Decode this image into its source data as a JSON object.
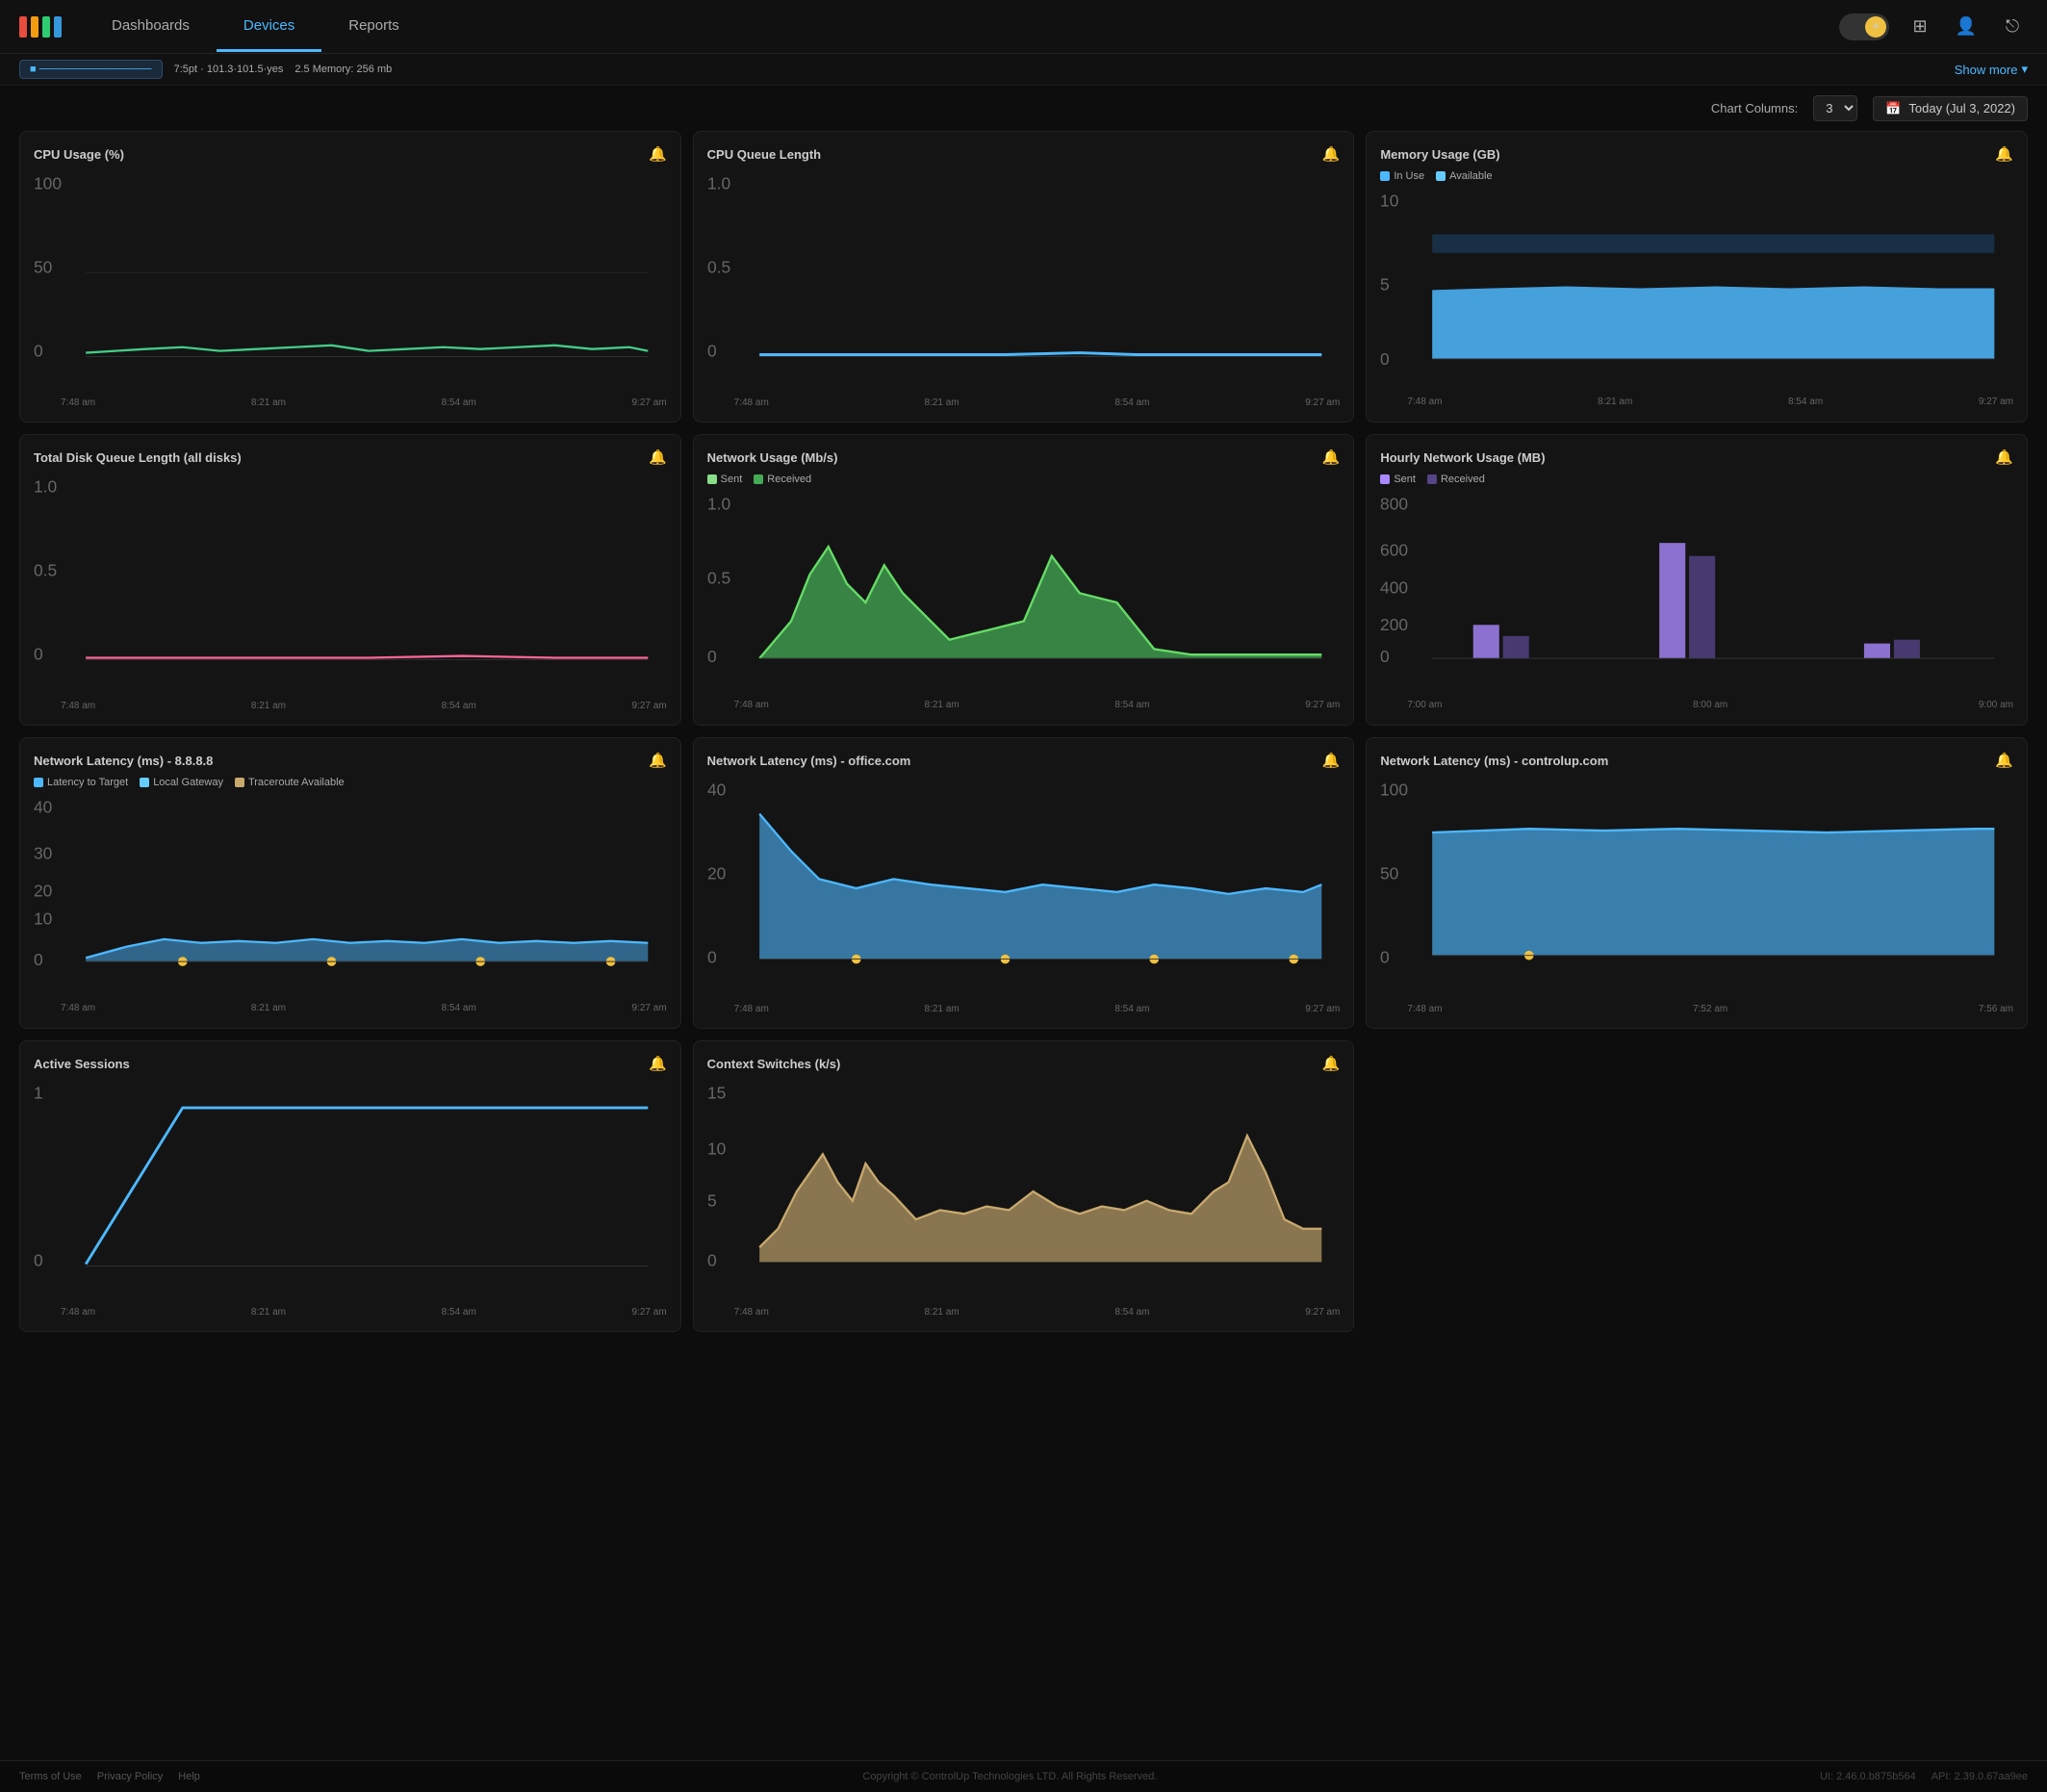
{
  "navbar": {
    "tabs": [
      {
        "id": "dashboards",
        "label": "Dashboards",
        "active": false
      },
      {
        "id": "devices",
        "label": "Devices",
        "active": true
      },
      {
        "id": "reports",
        "label": "Reports",
        "active": false
      }
    ],
    "theme_toggle_icon": "☀",
    "icons": [
      "⊞",
      "👤",
      "→"
    ]
  },
  "topbar": {
    "device_chip": "■ ────────────────",
    "info_items": [
      "7:5pt",
      "101.3·101.5·yes",
      "2.5 Memory: 256 mb"
    ],
    "show_more": "Show more"
  },
  "toolbar": {
    "chart_columns_label": "Chart Columns:",
    "columns_value": "3",
    "date_label": "Today (Jul 3, 2022)"
  },
  "charts": [
    {
      "id": "cpu-usage",
      "title": "CPU Usage (%)",
      "y_max": "100",
      "y_mid": "50",
      "y_min": "0",
      "x_labels": [
        "7:48 am",
        "8:21 am",
        "8:54 am",
        "9:27 am"
      ],
      "color": "#44cc88",
      "type": "line",
      "legend": []
    },
    {
      "id": "cpu-queue",
      "title": "CPU Queue Length",
      "y_max": "1.0",
      "y_mid": "0.5",
      "y_min": "0",
      "x_labels": [
        "7:48 am",
        "8:21 am",
        "8:54 am",
        "9:27 am"
      ],
      "color": "#4db8ff",
      "type": "line",
      "legend": []
    },
    {
      "id": "memory-usage",
      "title": "Memory Usage (GB)",
      "y_max": "10",
      "y_mid": "5",
      "y_min": "0",
      "x_labels": [
        "7:48 am",
        "8:21 am",
        "8:54 am",
        "9:27 am"
      ],
      "color": "#4db8ff",
      "type": "area",
      "legend": [
        {
          "label": "In Use",
          "color": "#4db8ff"
        },
        {
          "label": "Available",
          "color": "#66aaff"
        }
      ]
    },
    {
      "id": "disk-queue",
      "title": "Total Disk Queue Length (all disks)",
      "y_max": "1.0",
      "y_mid": "0.5",
      "y_min": "0",
      "x_labels": [
        "7:48 am",
        "8:21 am",
        "8:54 am",
        "9:27 am"
      ],
      "color": "#ff6699",
      "type": "line",
      "legend": []
    },
    {
      "id": "network-usage",
      "title": "Network Usage (Mb/s)",
      "y_max": "1.0",
      "y_mid": "0.5",
      "y_min": "0",
      "x_labels": [
        "7:48 am",
        "8:21 am",
        "8:54 am",
        "9:27 am"
      ],
      "color": "#55cc77",
      "type": "area",
      "legend": [
        {
          "label": "Sent",
          "color": "#88dd88"
        },
        {
          "label": "Received",
          "color": "#44aa55"
        }
      ]
    },
    {
      "id": "hourly-network",
      "title": "Hourly Network Usage (MB)",
      "y_max": "800",
      "y_mid": "400",
      "y_min": "0",
      "x_labels": [
        "7:00 am",
        "8:00 am",
        "9:00 am"
      ],
      "color": "#aa88ff",
      "type": "bar",
      "legend": [
        {
          "label": "Sent",
          "color": "#aa88ff"
        },
        {
          "label": "Received",
          "color": "#554488"
        }
      ]
    },
    {
      "id": "latency-888",
      "title": "Network Latency (ms) - 8.8.8.8",
      "y_max": "40",
      "y_mid": "20",
      "y_min": "0",
      "x_labels": [
        "7:48 am",
        "8:21 am",
        "8:54 am",
        "9:27 am"
      ],
      "color": "#4db8ff",
      "type": "area",
      "legend": [
        {
          "label": "Latency to Target",
          "color": "#4db8ff"
        },
        {
          "label": "Local Gateway",
          "color": "#66ccff"
        },
        {
          "label": "Traceroute Available",
          "color": "#c8a96e"
        }
      ]
    },
    {
      "id": "latency-office",
      "title": "Network Latency (ms) - office.com",
      "y_max": "40",
      "y_mid": "20",
      "y_min": "0",
      "x_labels": [
        "7:48 am",
        "8:21 am",
        "8:54 am",
        "9:27 am"
      ],
      "color": "#4db8ff",
      "type": "area",
      "legend": []
    },
    {
      "id": "latency-controlup",
      "title": "Network Latency (ms) - controlup.com",
      "y_max": "100",
      "y_mid": "50",
      "y_min": "0",
      "x_labels": [
        "7:48 am",
        "7:52 am",
        "7:56 am"
      ],
      "color": "#4db8ff",
      "type": "area",
      "legend": []
    },
    {
      "id": "active-sessions",
      "title": "Active Sessions",
      "y_max": "1",
      "y_mid": "",
      "y_min": "0",
      "x_labels": [
        "7:48 am",
        "8:21 am",
        "8:54 am",
        "9:27 am"
      ],
      "color": "#4db8ff",
      "type": "line",
      "legend": [],
      "span": 1
    },
    {
      "id": "context-switches",
      "title": "Context Switches (k/s)",
      "y_max": "15",
      "y_mid": "10",
      "y_min": "0",
      "y_low": "5",
      "x_labels": [
        "7:48 am",
        "8:21 am",
        "8:54 am",
        "9:27 am"
      ],
      "color": "#c8a96e",
      "type": "area",
      "legend": []
    }
  ],
  "footer": {
    "links": [
      "Terms of Use",
      "Privacy Policy",
      "Help"
    ],
    "copyright": "Copyright © ControlUp Technologies LTD. All Rights Reserved.",
    "ui_version": "UI: 2.46.0.b875b564",
    "api_version": "API: 2.39.0.67aa9ee"
  }
}
